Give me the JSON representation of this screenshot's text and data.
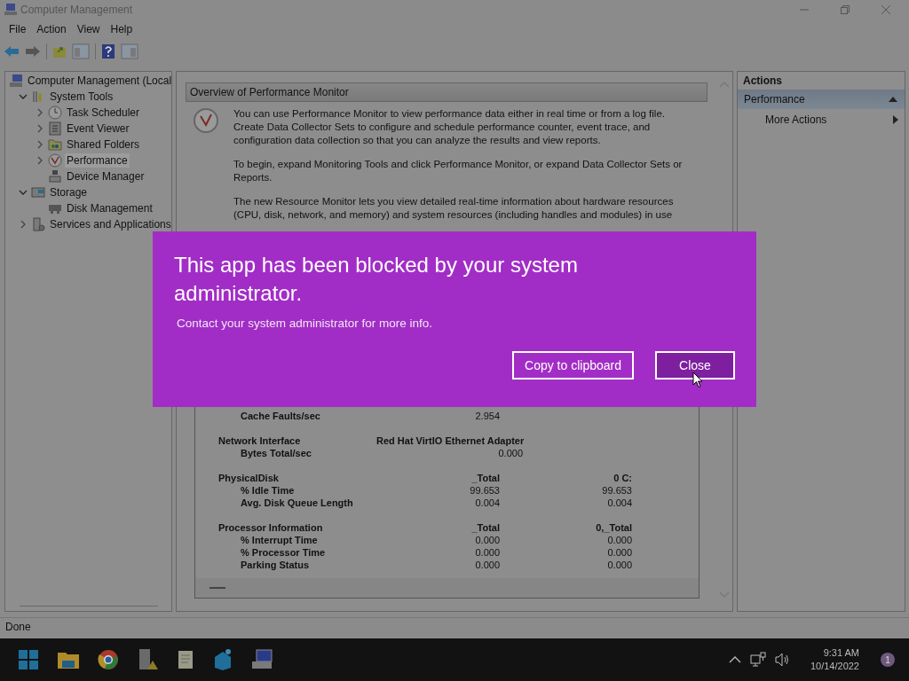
{
  "window": {
    "title": "Computer Management"
  },
  "menu": [
    "File",
    "Action",
    "View",
    "Help"
  ],
  "tree": [
    {
      "label": "Computer Management (Local",
      "selected": false,
      "children": [
        {
          "label": "System Tools",
          "expanded": true,
          "selected": false,
          "children": [
            {
              "label": "Task Scheduler",
              "expandable": true,
              "selected": false
            },
            {
              "label": "Event Viewer",
              "expandable": true,
              "selected": false
            },
            {
              "label": "Shared Folders",
              "expandable": true,
              "selected": false
            },
            {
              "label": "Performance",
              "expandable": true,
              "selected": true
            },
            {
              "label": "Device Manager",
              "expandable": false,
              "selected": false
            }
          ]
        },
        {
          "label": "Storage",
          "expanded": true,
          "selected": false,
          "children": [
            {
              "label": "Disk Management",
              "expandable": false,
              "selected": false
            }
          ]
        },
        {
          "label": "Services and Applications",
          "expandable": true,
          "selected": false
        }
      ]
    }
  ],
  "overview": {
    "title": "Overview of Performance Monitor",
    "paragraphs": [
      "You can use Performance Monitor to view performance data either in real time or from a log file. Create Data Collector Sets to configure and schedule performance counter, event trace, and configuration data collection so that you can analyze the results and view reports.",
      "To begin, expand Monitoring Tools and click Performance Monitor, or expand Data Collector Sets or Reports.",
      "The new Resource Monitor lets you view detailed real-time information about hardware resources (CPU, disk, network, and memory) and system resources (including handles and modules) in use"
    ]
  },
  "stats": [
    {
      "rows": [
        {
          "label": "Cache Faults/sec",
          "values": [
            "2.954"
          ]
        }
      ]
    },
    {
      "name": "Network Interface",
      "columns": [
        "Red Hat VirtIO Ethernet Adapter"
      ],
      "rows": [
        {
          "label": "Bytes Total/sec",
          "values": [
            "0.000"
          ]
        }
      ]
    },
    {
      "name": "PhysicalDisk",
      "columns": [
        "_Total",
        "0 C:"
      ],
      "rows": [
        {
          "label": "% Idle Time",
          "values": [
            "99.653",
            "99.653"
          ]
        },
        {
          "label": "Avg. Disk Queue Length",
          "values": [
            "0.004",
            "0.004"
          ]
        }
      ]
    },
    {
      "name": "Processor Information",
      "columns": [
        "_Total",
        "0,_Total"
      ],
      "rows": [
        {
          "label": "% Interrupt Time",
          "values": [
            "0.000",
            "0.000"
          ]
        },
        {
          "label": "% Processor Time",
          "values": [
            "0.000",
            "0.000"
          ]
        },
        {
          "label": "Parking Status",
          "values": [
            "0.000",
            "0.000"
          ]
        }
      ]
    }
  ],
  "actions": {
    "title": "Actions",
    "sections": [
      {
        "title": "Performance",
        "expanded": true,
        "items": [
          {
            "label": "More Actions",
            "submenu": true
          }
        ]
      }
    ]
  },
  "status_bar": "Done",
  "dialog": {
    "title": "This app has been blocked by your system administrator.",
    "message": "Contact your system administrator for more info.",
    "buttons": [
      {
        "label": "Copy to clipboard",
        "default": false
      },
      {
        "label": "Close",
        "default": true
      }
    ]
  },
  "taskbar": {
    "time": "9:31 AM",
    "date": "10/14/2022",
    "notifications": "1"
  }
}
